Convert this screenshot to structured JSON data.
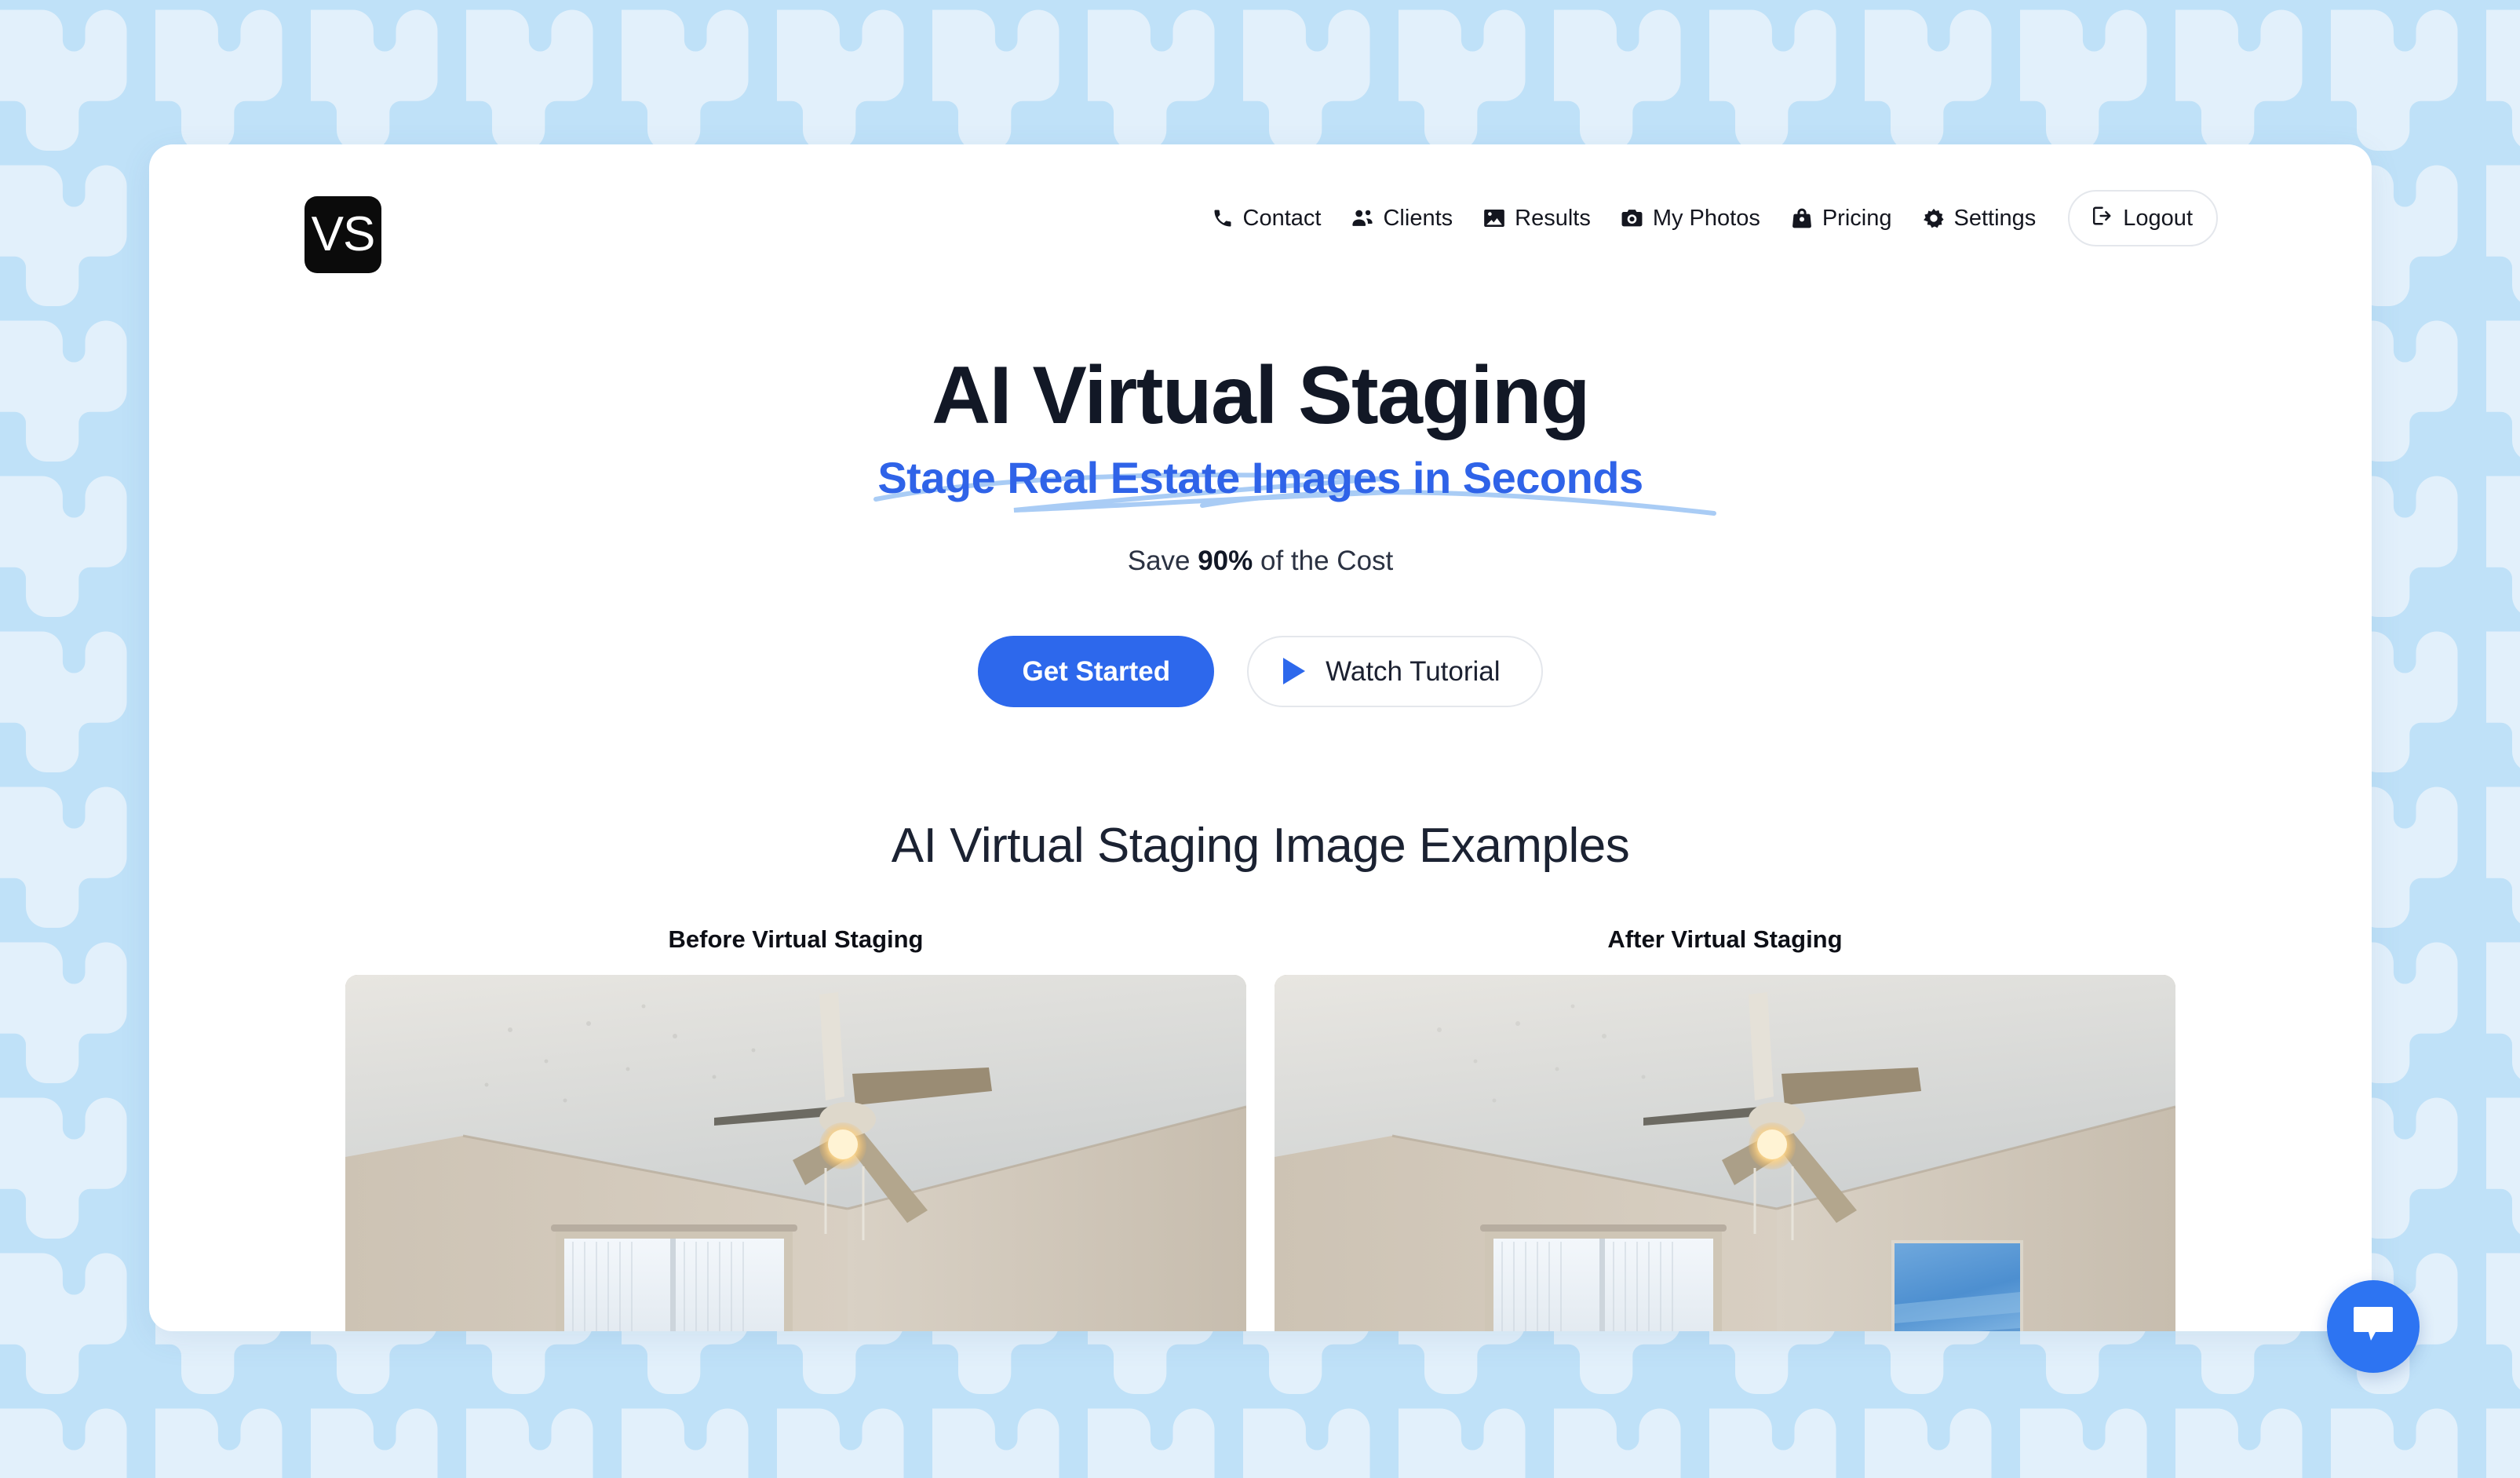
{
  "theme": {
    "page_bg": "#bfe1f8",
    "pattern_motif": "#e2f0fb",
    "card_bg": "#ffffff",
    "accent_blue": "#2d68ec",
    "subtitle_blue": "#2f63e8",
    "heading_navy": "#121826",
    "logo_bg": "#0b0b0b",
    "chat_blue": "#2d74f2"
  },
  "header": {
    "logo_text": "VS",
    "nav": [
      {
        "label": "Contact",
        "icon": "phone-icon"
      },
      {
        "label": "Clients",
        "icon": "people-icon"
      },
      {
        "label": "Results",
        "icon": "image-icon"
      },
      {
        "label": "My Photos",
        "icon": "camera-icon"
      },
      {
        "label": "Pricing",
        "icon": "shopping-bag-icon"
      },
      {
        "label": "Settings",
        "icon": "gear-icon"
      }
    ],
    "logout": {
      "label": "Logout",
      "icon": "logout-icon"
    }
  },
  "hero": {
    "title": "AI Virtual Staging",
    "subtitle": "Stage Real Estate Images in Seconds",
    "tagline_prefix": "Save ",
    "tagline_strong": "90%",
    "tagline_suffix": " of the Cost",
    "primary_cta": "Get Started",
    "secondary_cta": "Watch Tutorial",
    "secondary_cta_icon": "play-icon"
  },
  "examples": {
    "title": "AI Virtual Staging Image Examples",
    "items": [
      {
        "label": "Before Virtual Staging",
        "alt": "Empty bedroom corner with ceiling fan, textured ceiling and curtained window"
      },
      {
        "label": "After Virtual Staging",
        "alt": "Same bedroom corner virtually staged with a blue framed artwork on the right wall"
      }
    ]
  },
  "chat": {
    "icon": "chat-bubble-icon",
    "label": "Open chat"
  }
}
